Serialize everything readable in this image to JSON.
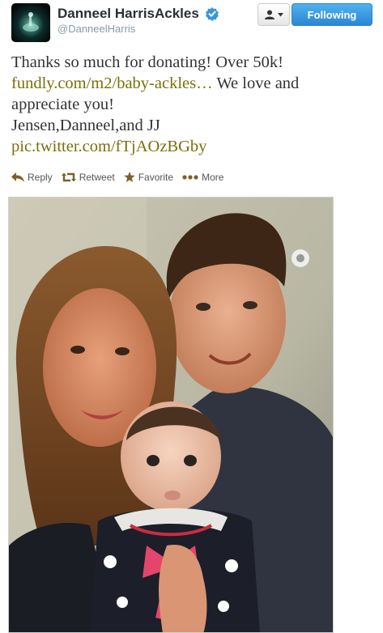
{
  "user": {
    "name": "Danneel HarrisAckles",
    "handle": "@DanneelHarris",
    "verified": true,
    "avatar_icon": "avatar-image"
  },
  "follow_button": {
    "label": "Following"
  },
  "user_dropdown": {
    "icon": "user-dropdown-icon"
  },
  "tweet": {
    "line1": "Thanks so much for donating! Over 50k!",
    "link1": "fundly.com/m2/baby-ackles…",
    "line2_rest": " We love and",
    "line3": "appreciate you!",
    "line4": "Jensen,Danneel,and JJ",
    "link2": "pic.twitter.com/fTjAOzBGby"
  },
  "actions": {
    "reply": "Reply",
    "retweet": "Retweet",
    "favorite": "Favorite",
    "more": "More"
  },
  "colors": {
    "link": "#7a6f0a",
    "follow_button": "#2a86d5",
    "verified_badge": "#3b94d9"
  }
}
